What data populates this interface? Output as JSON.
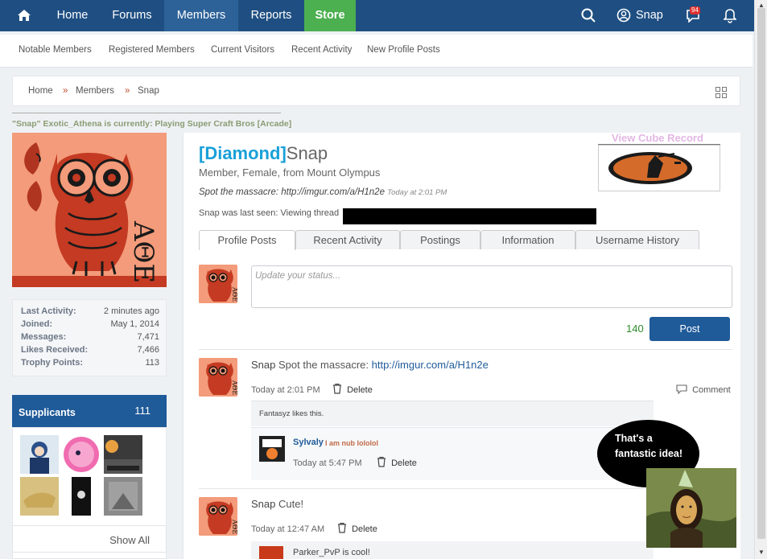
{
  "nav": {
    "home_icon": "home-icon",
    "items": [
      "Forums",
      "Members",
      "Reports",
      "Store"
    ],
    "search_icon": "search-icon",
    "user": "Snap",
    "messages_badge": "94"
  },
  "subnav": [
    "Notable Members",
    "Registered Members",
    "Current Visitors",
    "Recent Activity",
    "New Profile Posts"
  ],
  "breadcrumb": {
    "home": "Home",
    "sep": "»",
    "members": "Members",
    "current": "Snap"
  },
  "status_line": "\"Snap\" Exotic_Athena is currently: Playing Super Craft Bros [Arcade]",
  "stats": [
    {
      "k": "Last Activity:",
      "v": "2 minutes ago"
    },
    {
      "k": "Joined:",
      "v": "May 1, 2014"
    },
    {
      "k": "Messages:",
      "v": "7,471"
    },
    {
      "k": "Likes Received:",
      "v": "7,466"
    },
    {
      "k": "Trophy Points:",
      "v": "113"
    }
  ],
  "supplicants": {
    "title": "Supplicants",
    "count": "111",
    "show_all": "Show All"
  },
  "profile": {
    "rank": "[Diamond]",
    "name": "Snap",
    "subtitle": "Member, Female, from Mount Olympus",
    "status": "Spot the massacre: http://imgur.com/a/H1n2e",
    "status_time": "Today at 2:01 PM",
    "last_seen": "Snap was last seen: Viewing thread",
    "cube_record": "View Cube Record"
  },
  "tabs": [
    "Profile Posts",
    "Recent Activity",
    "Postings",
    "Information",
    "Username History"
  ],
  "composer": {
    "placeholder": "Update your status...",
    "counter": "140",
    "post": "Post"
  },
  "posts": [
    {
      "author": "Snap",
      "text": "Spot the massacre: ",
      "link": "http://imgur.com/a/H1n2e",
      "time": "Today at 2:01 PM",
      "delete": "Delete",
      "comment": "Comment",
      "likes": "Fantasyz likes this."
    },
    {
      "author": "Snap",
      "text": "Cute!",
      "time": "Today at 12:47 AM",
      "delete": "Delete",
      "likes": "Parker_PvP is cool!"
    }
  ],
  "reply": {
    "author": "Sylvaly",
    "text": "I am nub lololol",
    "time": "Today at 5:47 PM",
    "delete": "Delete"
  },
  "bubble": {
    "line1": "That's a",
    "line2": "fantastic idea!"
  }
}
